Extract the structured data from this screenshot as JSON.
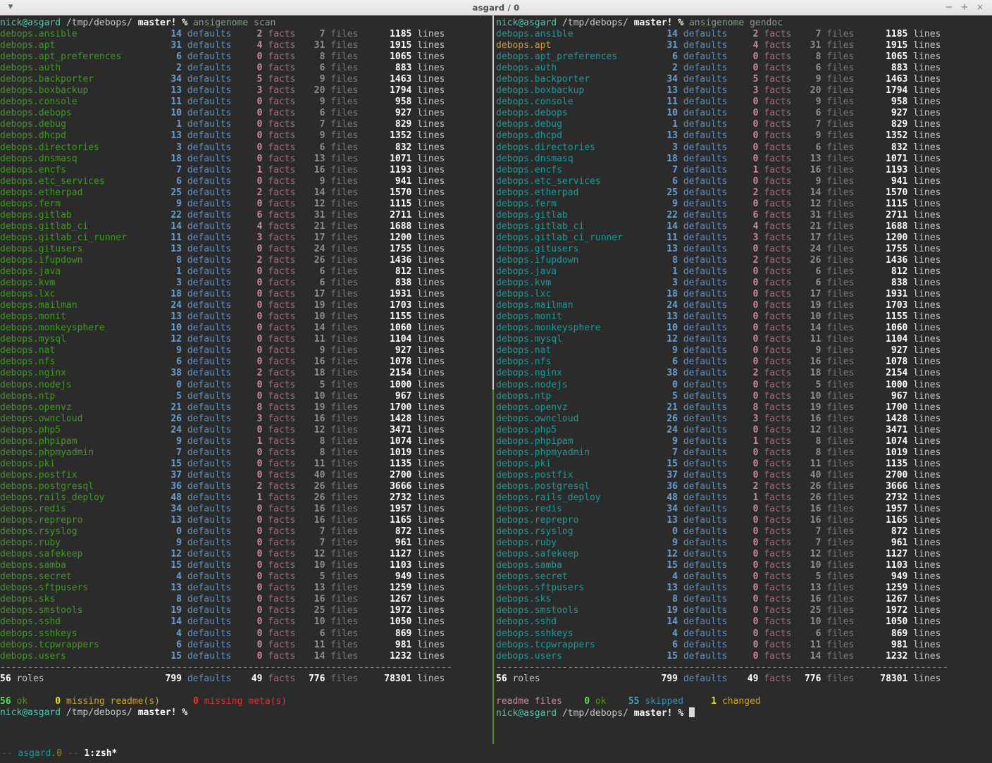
{
  "window": {
    "title": "asgard / 0",
    "menu_icon": "chevron-down-icon",
    "minimize_label": "−",
    "maximize_label": "+",
    "close_label": "×"
  },
  "prompt": {
    "user": "nick",
    "at": "@",
    "host": "asgard",
    "path": "/tmp/debops/",
    "branch": "master!",
    "symbol": "%"
  },
  "panes": [
    {
      "id": "left",
      "active": false,
      "command": "ansigenome scan",
      "role_color": "green",
      "summary_line": {
        "count": "56",
        "count_label": "ok",
        "missing_readme_num": "0",
        "missing_readme_label": "missing readme(s)",
        "missing_meta_num": "0",
        "missing_meta_label": "missing meta(s)"
      },
      "cursor": false
    },
    {
      "id": "right",
      "active": true,
      "command": "ansigenome gendoc",
      "role_color": "cyan",
      "highlight_role": "debops.apt",
      "summary_line": {
        "prefix": "readme files",
        "ok_num": "0",
        "ok_label": "ok",
        "skipped_num": "55",
        "skipped_label": "skipped",
        "changed_num": "1",
        "changed_label": "changed"
      },
      "cursor": true
    }
  ],
  "columns": {
    "defaults": "defaults",
    "facts": "facts",
    "files": "files",
    "lines": "lines",
    "roles": "roles"
  },
  "totals": {
    "roles_count": "56",
    "roles_label": "roles",
    "defaults": "799",
    "facts": "49",
    "files": "776",
    "lines": "78301"
  },
  "rows": [
    {
      "role": "debops.ansible",
      "defaults": "14",
      "facts": "2",
      "files": "7",
      "lines": "1185"
    },
    {
      "role": "debops.apt",
      "defaults": "31",
      "facts": "4",
      "files": "31",
      "lines": "1915"
    },
    {
      "role": "debops.apt_preferences",
      "defaults": "6",
      "facts": "0",
      "files": "8",
      "lines": "1065"
    },
    {
      "role": "debops.auth",
      "defaults": "2",
      "facts": "0",
      "files": "6",
      "lines": "883"
    },
    {
      "role": "debops.backporter",
      "defaults": "34",
      "facts": "5",
      "files": "9",
      "lines": "1463"
    },
    {
      "role": "debops.boxbackup",
      "defaults": "13",
      "facts": "3",
      "files": "20",
      "lines": "1794"
    },
    {
      "role": "debops.console",
      "defaults": "11",
      "facts": "0",
      "files": "9",
      "lines": "958"
    },
    {
      "role": "debops.debops",
      "defaults": "10",
      "facts": "0",
      "files": "6",
      "lines": "927"
    },
    {
      "role": "debops.debug",
      "defaults": "1",
      "facts": "0",
      "files": "7",
      "lines": "829"
    },
    {
      "role": "debops.dhcpd",
      "defaults": "13",
      "facts": "0",
      "files": "9",
      "lines": "1352"
    },
    {
      "role": "debops.directories",
      "defaults": "3",
      "facts": "0",
      "files": "6",
      "lines": "832"
    },
    {
      "role": "debops.dnsmasq",
      "defaults": "18",
      "facts": "0",
      "files": "13",
      "lines": "1071"
    },
    {
      "role": "debops.encfs",
      "defaults": "7",
      "facts": "1",
      "files": "16",
      "lines": "1193"
    },
    {
      "role": "debops.etc_services",
      "defaults": "6",
      "facts": "0",
      "files": "9",
      "lines": "941"
    },
    {
      "role": "debops.etherpad",
      "defaults": "25",
      "facts": "2",
      "files": "14",
      "lines": "1570"
    },
    {
      "role": "debops.ferm",
      "defaults": "9",
      "facts": "0",
      "files": "12",
      "lines": "1115"
    },
    {
      "role": "debops.gitlab",
      "defaults": "22",
      "facts": "6",
      "files": "31",
      "lines": "2711"
    },
    {
      "role": "debops.gitlab_ci",
      "defaults": "14",
      "facts": "4",
      "files": "21",
      "lines": "1688"
    },
    {
      "role": "debops.gitlab_ci_runner",
      "defaults": "11",
      "facts": "3",
      "files": "17",
      "lines": "1200"
    },
    {
      "role": "debops.gitusers",
      "defaults": "13",
      "facts": "0",
      "files": "24",
      "lines": "1755"
    },
    {
      "role": "debops.ifupdown",
      "defaults": "8",
      "facts": "2",
      "files": "26",
      "lines": "1436"
    },
    {
      "role": "debops.java",
      "defaults": "1",
      "facts": "0",
      "files": "6",
      "lines": "812"
    },
    {
      "role": "debops.kvm",
      "defaults": "3",
      "facts": "0",
      "files": "6",
      "lines": "838"
    },
    {
      "role": "debops.lxc",
      "defaults": "18",
      "facts": "0",
      "files": "17",
      "lines": "1931"
    },
    {
      "role": "debops.mailman",
      "defaults": "24",
      "facts": "0",
      "files": "19",
      "lines": "1703"
    },
    {
      "role": "debops.monit",
      "defaults": "13",
      "facts": "0",
      "files": "10",
      "lines": "1155"
    },
    {
      "role": "debops.monkeysphere",
      "defaults": "10",
      "facts": "0",
      "files": "14",
      "lines": "1060"
    },
    {
      "role": "debops.mysql",
      "defaults": "12",
      "facts": "0",
      "files": "11",
      "lines": "1104"
    },
    {
      "role": "debops.nat",
      "defaults": "9",
      "facts": "0",
      "files": "9",
      "lines": "927"
    },
    {
      "role": "debops.nfs",
      "defaults": "6",
      "facts": "0",
      "files": "16",
      "lines": "1078"
    },
    {
      "role": "debops.nginx",
      "defaults": "38",
      "facts": "2",
      "files": "18",
      "lines": "2154"
    },
    {
      "role": "debops.nodejs",
      "defaults": "0",
      "facts": "0",
      "files": "5",
      "lines": "1000"
    },
    {
      "role": "debops.ntp",
      "defaults": "5",
      "facts": "0",
      "files": "10",
      "lines": "967"
    },
    {
      "role": "debops.openvz",
      "defaults": "21",
      "facts": "8",
      "files": "19",
      "lines": "1700"
    },
    {
      "role": "debops.owncloud",
      "defaults": "26",
      "facts": "3",
      "files": "16",
      "lines": "1428"
    },
    {
      "role": "debops.php5",
      "defaults": "24",
      "facts": "0",
      "files": "12",
      "lines": "3471"
    },
    {
      "role": "debops.phpipam",
      "defaults": "9",
      "facts": "1",
      "files": "8",
      "lines": "1074"
    },
    {
      "role": "debops.phpmyadmin",
      "defaults": "7",
      "facts": "0",
      "files": "8",
      "lines": "1019"
    },
    {
      "role": "debops.pki",
      "defaults": "15",
      "facts": "0",
      "files": "11",
      "lines": "1135"
    },
    {
      "role": "debops.postfix",
      "defaults": "37",
      "facts": "0",
      "files": "40",
      "lines": "2700"
    },
    {
      "role": "debops.postgresql",
      "defaults": "36",
      "facts": "2",
      "files": "26",
      "lines": "3666"
    },
    {
      "role": "debops.rails_deploy",
      "defaults": "48",
      "facts": "1",
      "files": "26",
      "lines": "2732"
    },
    {
      "role": "debops.redis",
      "defaults": "34",
      "facts": "0",
      "files": "16",
      "lines": "1957"
    },
    {
      "role": "debops.reprepro",
      "defaults": "13",
      "facts": "0",
      "files": "16",
      "lines": "1165"
    },
    {
      "role": "debops.rsyslog",
      "defaults": "0",
      "facts": "0",
      "files": "7",
      "lines": "872"
    },
    {
      "role": "debops.ruby",
      "defaults": "9",
      "facts": "0",
      "files": "7",
      "lines": "961"
    },
    {
      "role": "debops.safekeep",
      "defaults": "12",
      "facts": "0",
      "files": "12",
      "lines": "1127"
    },
    {
      "role": "debops.samba",
      "defaults": "15",
      "facts": "0",
      "files": "10",
      "lines": "1103"
    },
    {
      "role": "debops.secret",
      "defaults": "4",
      "facts": "0",
      "files": "5",
      "lines": "949"
    },
    {
      "role": "debops.sftpusers",
      "defaults": "13",
      "facts": "0",
      "files": "13",
      "lines": "1259"
    },
    {
      "role": "debops.sks",
      "defaults": "8",
      "facts": "0",
      "files": "16",
      "lines": "1267"
    },
    {
      "role": "debops.smstools",
      "defaults": "19",
      "facts": "0",
      "files": "25",
      "lines": "1972"
    },
    {
      "role": "debops.sshd",
      "defaults": "14",
      "facts": "0",
      "files": "10",
      "lines": "1050"
    },
    {
      "role": "debops.sshkeys",
      "defaults": "4",
      "facts": "0",
      "files": "6",
      "lines": "869"
    },
    {
      "role": "debops.tcpwrappers",
      "defaults": "6",
      "facts": "0",
      "files": "11",
      "lines": "981"
    },
    {
      "role": "debops.users",
      "defaults": "15",
      "facts": "0",
      "files": "14",
      "lines": "1232"
    }
  ],
  "separator": "----------------------------------------------------------------------------------",
  "statusbar": {
    "left_dashes": "--",
    "session": "asgard",
    "session_dot": ".",
    "session_index": "0",
    "mid_dashes": "--",
    "window": "1:zsh*"
  }
}
